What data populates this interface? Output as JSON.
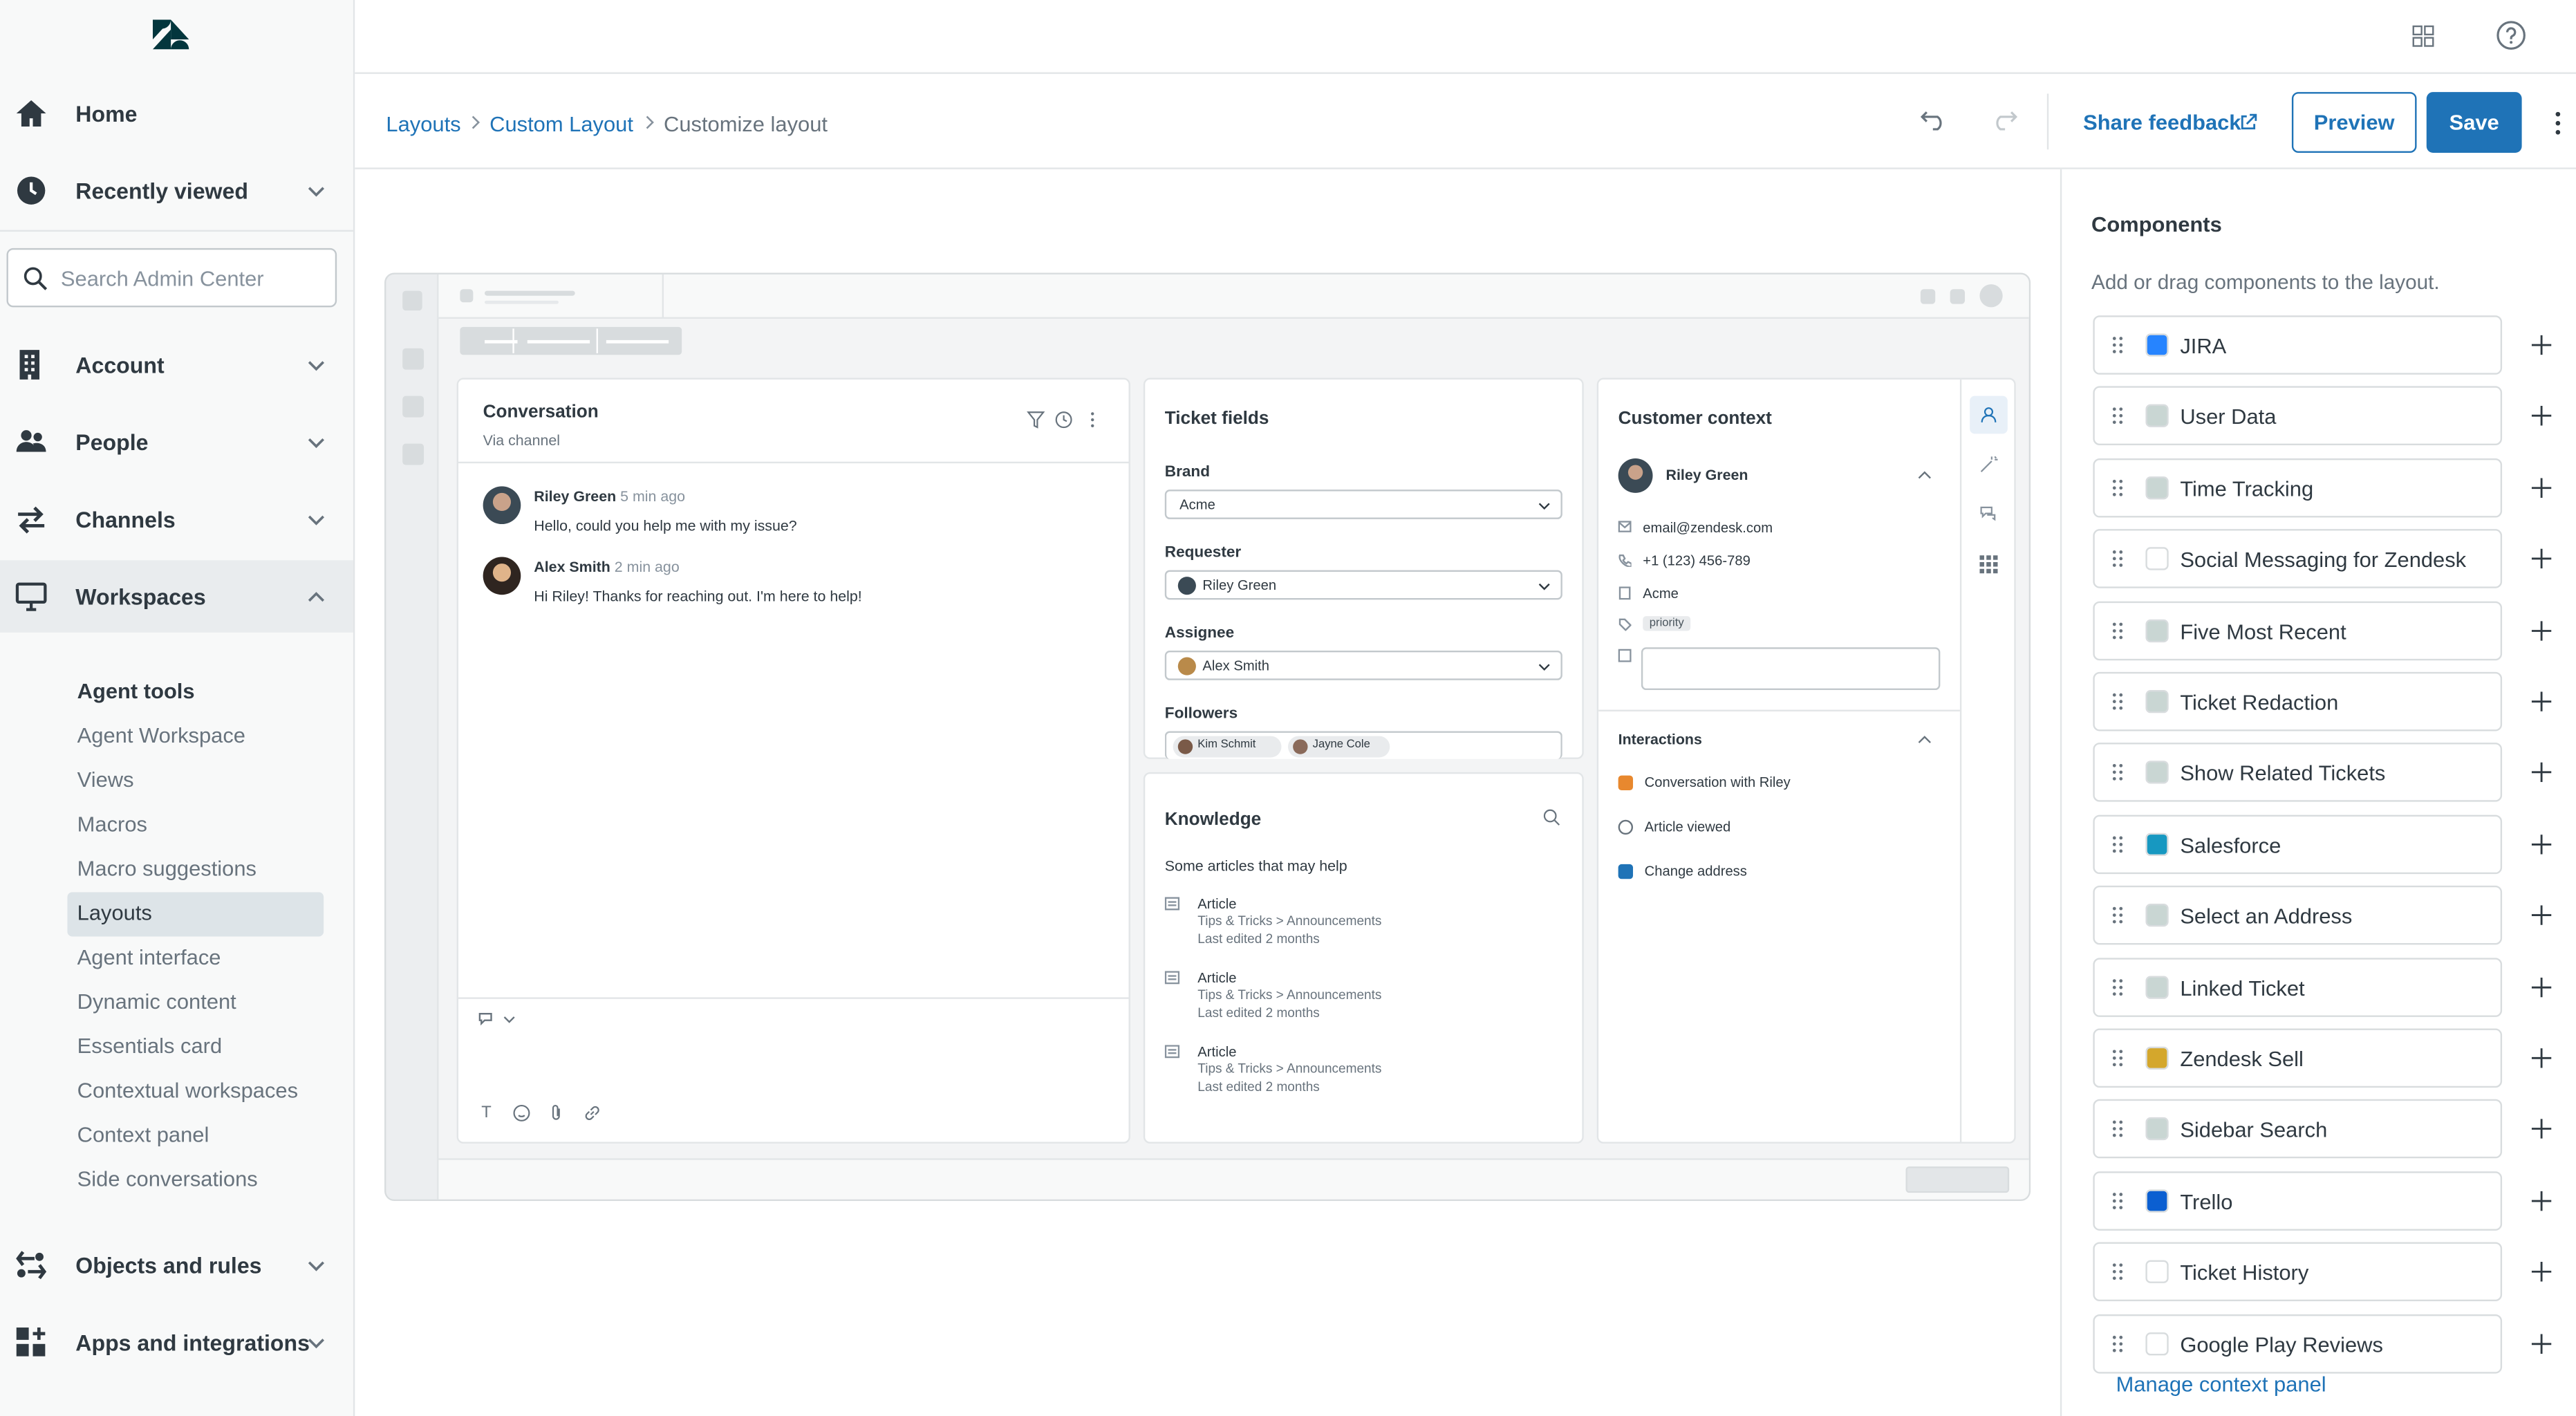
{
  "sidebar": {
    "nav_top": [
      {
        "label": "Home",
        "icon": "home-icon"
      },
      {
        "label": "Recently viewed",
        "icon": "clock-icon"
      }
    ],
    "search_placeholder": "Search Admin Center",
    "nav_main": [
      {
        "label": "Account",
        "icon": "building-icon"
      },
      {
        "label": "People",
        "icon": "people-icon"
      },
      {
        "label": "Channels",
        "icon": "arrows-icon"
      },
      {
        "label": "Workspaces",
        "icon": "monitor-icon"
      }
    ],
    "subsection_title": "Agent tools",
    "sub_items": [
      "Agent Workspace",
      "Views",
      "Macros",
      "Macro suggestions",
      "Layouts",
      "Agent interface",
      "Dynamic content",
      "Essentials card",
      "Contextual workspaces",
      "Context panel",
      "Side conversations"
    ],
    "active_sub_item": "Layouts",
    "nav_bottom": [
      {
        "label": "Objects and rules",
        "icon": "objects-icon"
      },
      {
        "label": "Apps and integrations",
        "icon": "apps-icon"
      }
    ]
  },
  "header": {
    "breadcrumbs": [
      "Layouts",
      "Custom Layout",
      "Customize layout"
    ],
    "share_feedback": "Share feedback",
    "preview_label": "Preview",
    "save_label": "Save"
  },
  "preview": {
    "conversation": {
      "title": "Conversation",
      "subtitle": "Via channel",
      "messages": [
        {
          "author": "Riley Green",
          "time": "5 min ago",
          "text": "Hello, could you help me with my issue?"
        },
        {
          "author": "Alex Smith",
          "time": "2 min ago",
          "text": "Hi Riley! Thanks for reaching out. I'm here to help!"
        }
      ]
    },
    "ticket_fields": {
      "title": "Ticket fields",
      "brand_label": "Brand",
      "brand_value": "Acme",
      "requester_label": "Requester",
      "requester_value": "Riley Green",
      "assignee_label": "Assignee",
      "assignee_value": "Alex Smith",
      "followers_label": "Followers",
      "followers": [
        "Kim Schmit",
        "Jayne Cole"
      ]
    },
    "knowledge": {
      "title": "Knowledge",
      "subtitle": "Some articles that may help",
      "articles": [
        {
          "title": "Article",
          "path": "Tips & Tricks > Announcements",
          "edited": "Last edited 2 months"
        },
        {
          "title": "Article",
          "path": "Tips & Tricks > Announcements",
          "edited": "Last edited 2 months"
        },
        {
          "title": "Article",
          "path": "Tips & Tricks > Announcements",
          "edited": "Last edited 2 months"
        }
      ]
    },
    "customer_context": {
      "title": "Customer context",
      "name": "Riley Green",
      "email": "email@zendesk.com",
      "phone": "+1 (123) 456-789",
      "org": "Acme",
      "tag": "priority",
      "interactions_title": "Interactions",
      "interactions": [
        "Conversation with Riley",
        "Article viewed",
        "Change address"
      ]
    }
  },
  "components": {
    "title": "Components",
    "subtitle": "Add or drag components to the layout.",
    "items": [
      {
        "label": "JIRA",
        "color": "#2684ff"
      },
      {
        "label": "User Data",
        "color": "#c9d6d3"
      },
      {
        "label": "Time Tracking",
        "color": "#c9d6d3"
      },
      {
        "label": "Social Messaging for Zendesk",
        "color": "#ffffff"
      },
      {
        "label": "Five Most Recent",
        "color": "#c9d6d3"
      },
      {
        "label": "Ticket Redaction",
        "color": "#c9d6d3"
      },
      {
        "label": "Show Related Tickets",
        "color": "#c9d6d3"
      },
      {
        "label": "Salesforce",
        "color": "#1798c1"
      },
      {
        "label": "Select an Address",
        "color": "#c9d6d3"
      },
      {
        "label": "Linked Ticket",
        "color": "#c9d6d3"
      },
      {
        "label": "Zendesk Sell",
        "color": "#d4a72c"
      },
      {
        "label": "Sidebar Search",
        "color": "#c9d6d3"
      },
      {
        "label": "Trello",
        "color": "#0b5fd1"
      },
      {
        "label": "Ticket History",
        "color": "#ffffff"
      },
      {
        "label": "Google Play Reviews",
        "color": "#ffffff"
      }
    ],
    "manage_link": "Manage context panel"
  }
}
